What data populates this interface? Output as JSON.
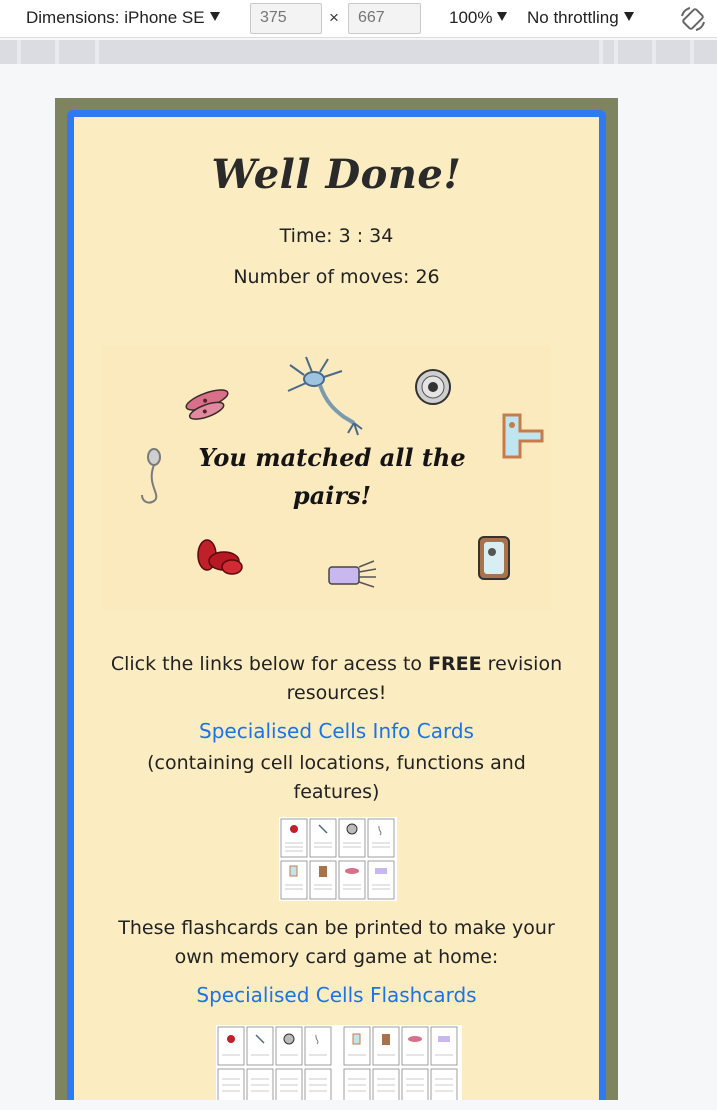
{
  "devtools": {
    "dimensions_label": "Dimensions: iPhone SE",
    "width": "375",
    "x_label": "×",
    "height": "667",
    "zoom": "100%",
    "throttling": "No throttling"
  },
  "game": {
    "title": "Well Done!",
    "time_text": "Time: 3 : 34",
    "moves_text": "Number of moves: 26",
    "matched_text": "You matched all the pairs!"
  },
  "resources": {
    "intro_before": "Click the links below for acess to ",
    "intro_bold": "FREE",
    "intro_after": " revision resources!",
    "info_cards_link": "Specialised Cells Info Cards",
    "info_cards_desc": "(containing cell locations, functions and features)",
    "flashcards_intro": "These flashcards can be printed to make your own memory card game at home:",
    "flashcards_link": "Specialised Cells Flashcards"
  },
  "colors": {
    "frame_border": "#2f79f3",
    "card_background": "#fbedc1",
    "viewport_background": "#7e8460",
    "link": "#1a73e8"
  }
}
